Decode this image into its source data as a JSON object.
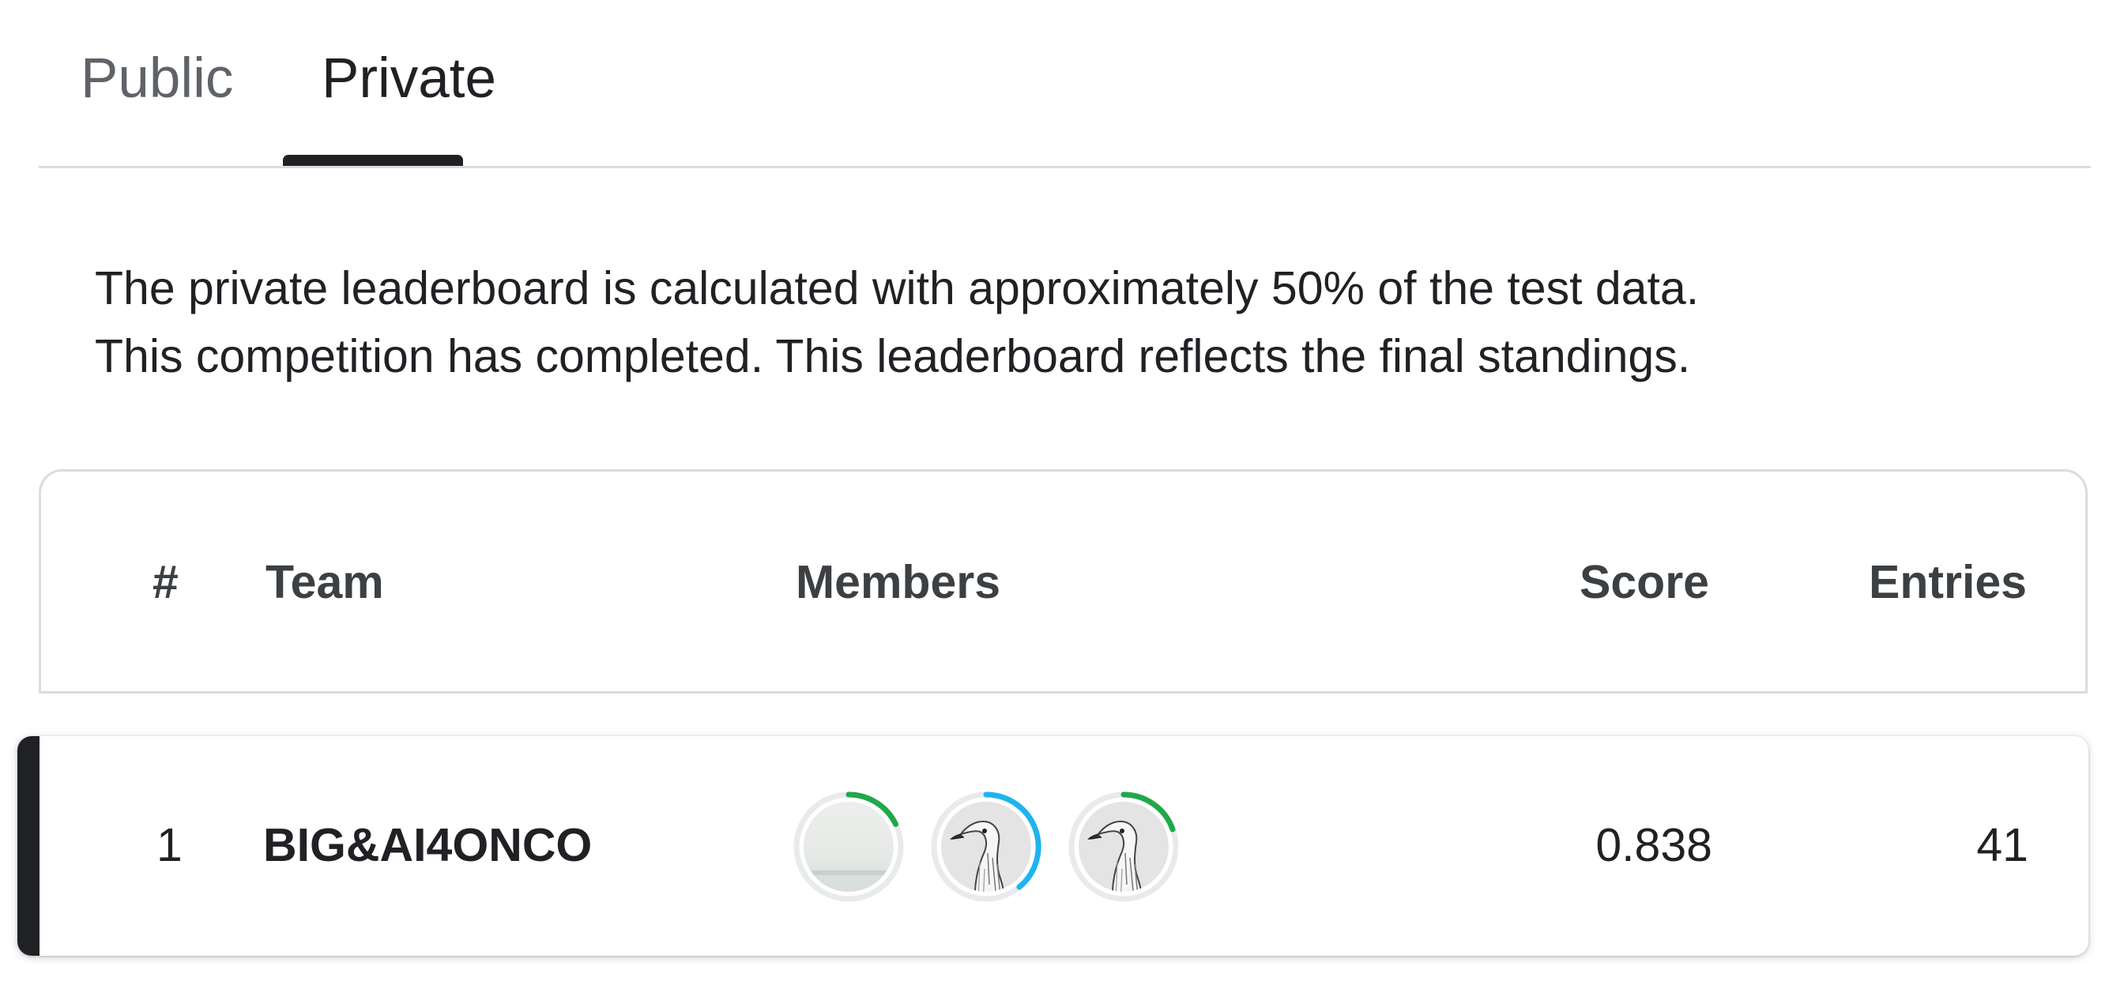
{
  "tabs": {
    "public_label": "Public",
    "private_label": "Private",
    "active": "Private"
  },
  "description": {
    "line1": "The private leaderboard is calculated with approximately 50% of the test data.",
    "line2": "This competition has completed. This leaderboard reflects the final standings."
  },
  "leaderboard": {
    "headers": {
      "rank": "#",
      "team": "Team",
      "members": "Members",
      "score": "Score",
      "entries": "Entries"
    },
    "rows": [
      {
        "rank": "1",
        "team": "BIG&AI4ONCO",
        "members": [
          {
            "avatar": "landscape-avatar",
            "ring_color": "#20a84a"
          },
          {
            "avatar": "goose-avatar",
            "ring_color": "#1eb4f0"
          },
          {
            "avatar": "goose-avatar",
            "ring_color": "#20a84a"
          }
        ],
        "score": "0.838",
        "entries": "41"
      }
    ]
  },
  "colors": {
    "text_primary": "#202124",
    "text_secondary": "#5f6368",
    "border": "#dadce0",
    "tier_green": "#20a84a",
    "tier_blue": "#1eb4f0"
  }
}
